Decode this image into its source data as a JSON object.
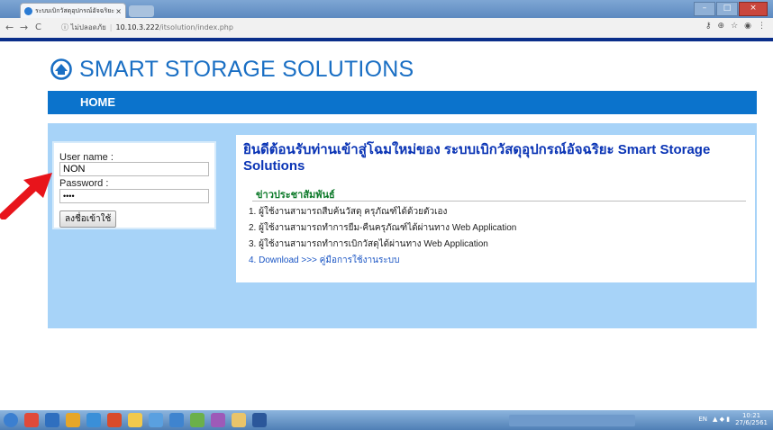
{
  "browser": {
    "tab_title": "ระบบเบิกวัสดุอุปกรณ์อัจฉริยะ",
    "tab_close": "×",
    "back": "←",
    "forward": "→",
    "reload": "C",
    "security_label": "ไม่ปลอดภัย",
    "url_host": "10.10.3.222",
    "url_path": "/itsolution/index.php",
    "window_min": "–",
    "window_max": "□",
    "window_close": "×"
  },
  "header": {
    "logo_text": "SMART STORAGE SOLUTIONS"
  },
  "nav": {
    "home": "HOME"
  },
  "login": {
    "username_label": "User name :",
    "username_value": "NON",
    "password_label": "Password :",
    "password_value": "••••",
    "submit_label": "ลงชื่อเข้าใช้"
  },
  "main": {
    "welcome": "ยินดีต้อนรับท่านเข้าสู่โฉมใหม่ของ ระบบเบิกวัสดุอุปกรณ์อัจฉริยะ Smart Storage Solutions",
    "news_heading": "ข่าวประชาสัมพันธ์",
    "news": [
      "1. ผู้ใช้งานสามารถสืบค้นวัสดุ ครุภัณฑ์ได้ด้วยตัวเอง",
      "2. ผู้ใช้งานสามารถทำการยืม-คืนครุภัณฑ์ได้ผ่านทาง Web Application",
      "3. ผู้ใช้งานสามารถทำการเบิกวัสดุได้ผ่านทาง Web Application",
      "4. Download >>> คู่มือการใช้งานระบบ"
    ]
  },
  "taskbar": {
    "lang": "EN",
    "time": "10:21",
    "date": "27/6/2561"
  },
  "colors": {
    "brand_blue": "#1a6fc4",
    "nav_blue": "#0b73cc",
    "panel_bg": "#a7d3f8",
    "welcome_text": "#0a34b5",
    "news_heading": "#0d7a2a",
    "arrow": "#e8141b"
  },
  "icons": [
    "tab-favicon-icon",
    "info-icon",
    "key-icon",
    "zoom-icon",
    "star-icon",
    "logo-icon",
    "red-arrow-icon"
  ]
}
